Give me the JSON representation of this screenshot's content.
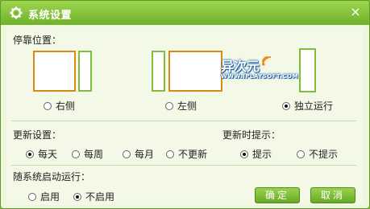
{
  "window": {
    "title": "系统设置",
    "close_glyph": "×"
  },
  "dock": {
    "title": "停靠位置：",
    "options": [
      {
        "label": "右侧",
        "checked": false
      },
      {
        "label": "左侧",
        "checked": false
      },
      {
        "label": "独立运行",
        "checked": true
      }
    ]
  },
  "update": {
    "title": "更新设置：",
    "options": [
      {
        "label": "每天",
        "checked": true
      },
      {
        "label": "每周",
        "checked": false
      },
      {
        "label": "每月",
        "checked": false
      },
      {
        "label": "不更新",
        "checked": false
      }
    ]
  },
  "update_hint": {
    "title": "更新时提示：",
    "options": [
      {
        "label": "提示",
        "checked": true
      },
      {
        "label": "不提示",
        "checked": false
      }
    ]
  },
  "autostart": {
    "title": "随系统启动运行：",
    "options": [
      {
        "label": "启用",
        "checked": false
      },
      {
        "label": "不启用",
        "checked": true
      }
    ]
  },
  "buttons": {
    "ok": "确定",
    "cancel": "取消"
  },
  "watermark": {
    "brand": "异次元",
    "url": "WWW.IPLAYSOFT.COM"
  },
  "colors": {
    "title_bar": "#7cb532",
    "dock_main": "#d98a14",
    "dock_side": "#7fbe3a",
    "button": "#7cb532"
  }
}
